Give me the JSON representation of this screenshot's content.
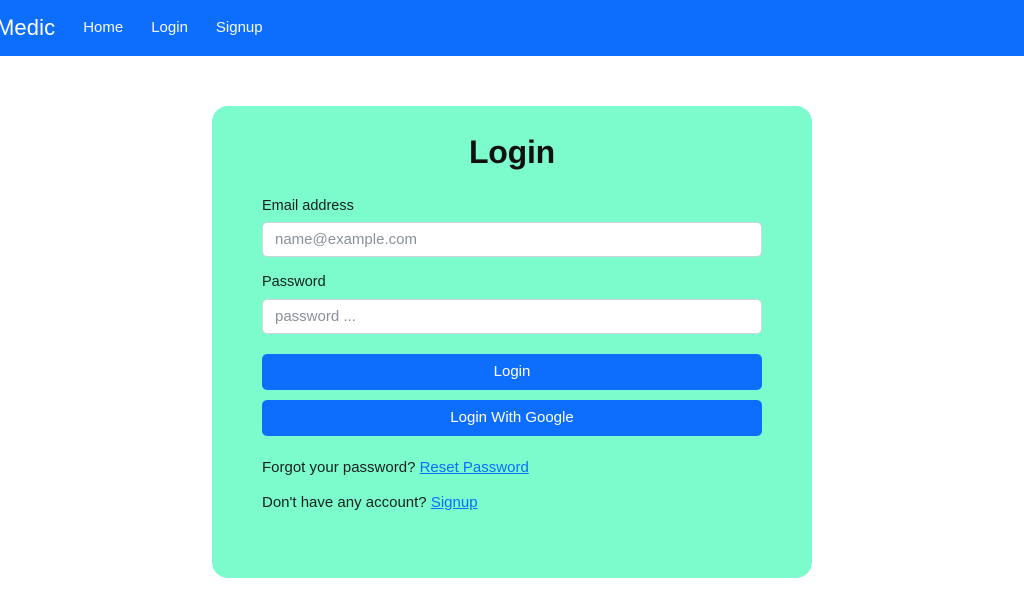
{
  "navbar": {
    "brand": "Medic",
    "links": [
      {
        "label": "Home",
        "name": "nav-link-home"
      },
      {
        "label": "Login",
        "name": "nav-link-login"
      },
      {
        "label": "Signup",
        "name": "nav-link-signup"
      }
    ],
    "background_color": "#0d6efd"
  },
  "card": {
    "title": "Login",
    "background_color": "#7cfbcd"
  },
  "form": {
    "email": {
      "label": "Email address",
      "placeholder": "name@example.com",
      "value": ""
    },
    "password": {
      "label": "Password",
      "placeholder": "password ...",
      "value": ""
    },
    "login_button": "Login",
    "google_button": "Login With Google",
    "button_color": "#0d6efd"
  },
  "footer": {
    "forgot_text": "Forgot your password?",
    "reset_link": "Reset Password",
    "no_account_text": "Don't have any account?",
    "signup_link": "Signup",
    "link_color": "#0d6efd"
  }
}
